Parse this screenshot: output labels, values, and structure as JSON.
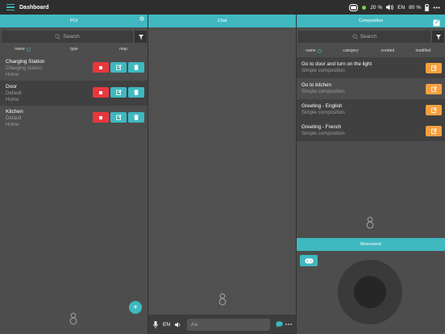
{
  "app": {
    "title": "Dashboard"
  },
  "status": {
    "battery_robot": "20 %",
    "language": "EN",
    "battery_device": "80 %"
  },
  "poi": {
    "title": "POI",
    "search_placeholder": "Search",
    "columns": [
      "name",
      "type",
      "map"
    ],
    "items": [
      {
        "name": "Charging Station",
        "type": "Charging station",
        "map": "Home"
      },
      {
        "name": "Door",
        "type": "Default",
        "map": "Home"
      },
      {
        "name": "Kitchen",
        "type": "Default",
        "map": "Home"
      }
    ]
  },
  "chat": {
    "title": "Chat",
    "language": "EN",
    "input_placeholder": "Aa"
  },
  "composition": {
    "title": "Composition",
    "search_placeholder": "Search",
    "columns": [
      "name",
      "category",
      "created",
      "modified"
    ],
    "items": [
      {
        "name": "Go to door and turn on the light",
        "type": "Simple composition"
      },
      {
        "name": "Go to kitchen",
        "type": "Simple composition"
      },
      {
        "name": "Greeting - English",
        "type": "Simple composition"
      },
      {
        "name": "Greeting - French",
        "type": "Simple composition"
      }
    ]
  },
  "movement": {
    "title": "Movement"
  },
  "colors": {
    "accent": "#3fb8c0",
    "danger": "#e8383d",
    "warning": "#f5a040",
    "topbar": "#2e2e2e"
  }
}
